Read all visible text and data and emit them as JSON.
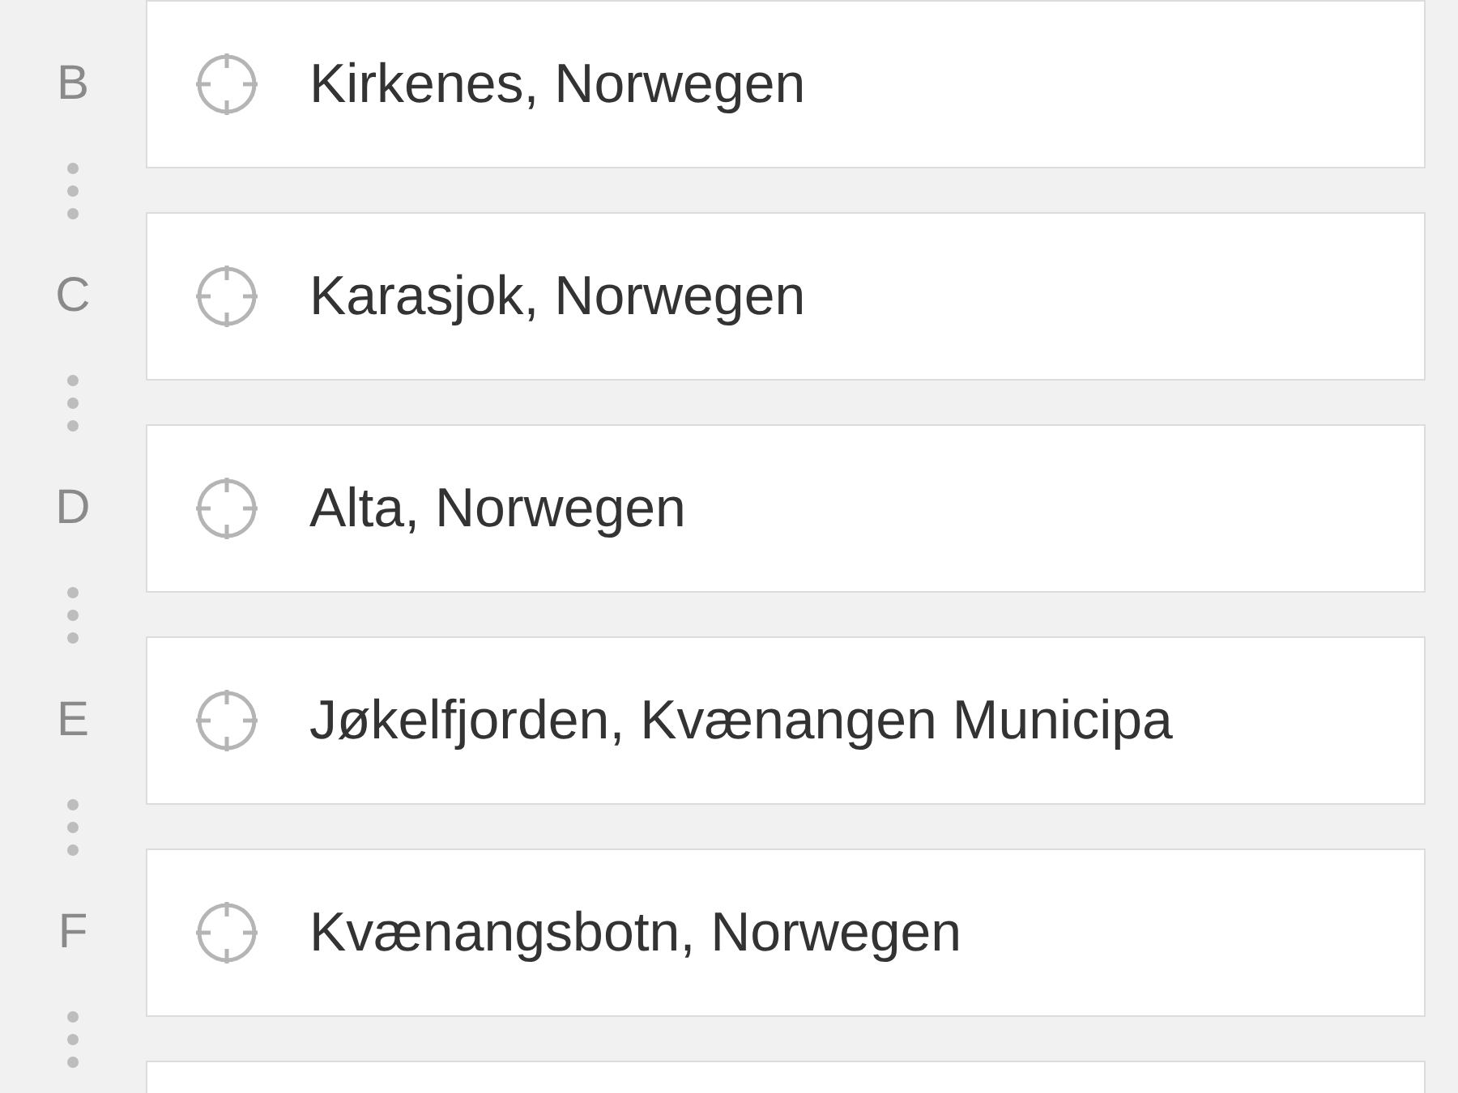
{
  "waypoints": [
    {
      "letter": "B",
      "place": "Kirkenes, Norwegen"
    },
    {
      "letter": "C",
      "place": "Karasjok, Norwegen"
    },
    {
      "letter": "D",
      "place": "Alta, Norwegen"
    },
    {
      "letter": "E",
      "place": "Jøkelfjorden, Kvænangen Municipa"
    },
    {
      "letter": "F",
      "place": "Kvænangsbotn, Norwegen"
    }
  ]
}
